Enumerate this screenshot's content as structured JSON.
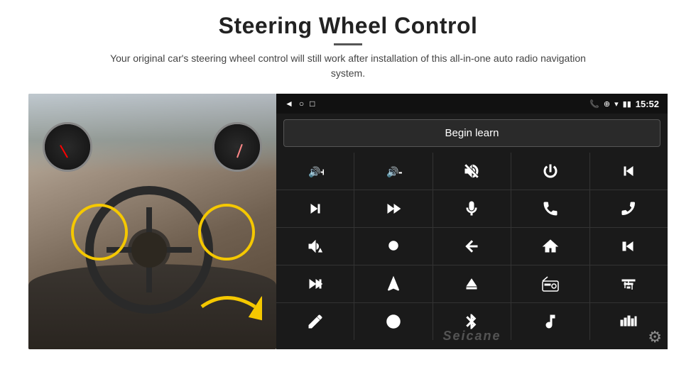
{
  "header": {
    "title": "Steering Wheel Control",
    "subtitle": "Your original car's steering wheel control will still work after installation of this all-in-one auto radio navigation system."
  },
  "statusbar": {
    "time": "15:52",
    "icons": [
      "◄",
      "○",
      "□",
      "📶",
      "📶"
    ]
  },
  "begin_learn": {
    "label": "Begin learn"
  },
  "controls": [
    {
      "icon": "vol_up",
      "symbol": "🔊+"
    },
    {
      "icon": "vol_down",
      "symbol": "🔊-"
    },
    {
      "icon": "mute",
      "symbol": "🔇"
    },
    {
      "icon": "power",
      "symbol": "⏻"
    },
    {
      "icon": "prev_track",
      "symbol": "⏮"
    },
    {
      "icon": "next_track",
      "symbol": "⏭"
    },
    {
      "icon": "ff_next",
      "symbol": "⏭⏭"
    },
    {
      "icon": "mic",
      "symbol": "🎤"
    },
    {
      "icon": "call",
      "symbol": "📞"
    },
    {
      "icon": "end_call",
      "symbol": "📵"
    },
    {
      "icon": "horn",
      "symbol": "📣"
    },
    {
      "icon": "settings_360",
      "symbol": "⚙360"
    },
    {
      "icon": "back",
      "symbol": "↩"
    },
    {
      "icon": "home",
      "symbol": "⌂"
    },
    {
      "icon": "rewind",
      "symbol": "⏮⏮"
    },
    {
      "icon": "ff",
      "symbol": "⏭"
    },
    {
      "icon": "navigation",
      "symbol": "▲"
    },
    {
      "icon": "eject",
      "symbol": "⏏"
    },
    {
      "icon": "radio",
      "symbol": "📻"
    },
    {
      "icon": "equalizer",
      "symbol": "🎚"
    },
    {
      "icon": "pen",
      "symbol": "✏"
    },
    {
      "icon": "steering2",
      "symbol": "🎯"
    },
    {
      "icon": "bluetooth",
      "symbol": "⚡"
    },
    {
      "icon": "music",
      "symbol": "🎵"
    },
    {
      "icon": "bars",
      "symbol": "|||"
    },
    {
      "icon": "gear",
      "symbol": "⚙"
    }
  ],
  "watermark": "Seicane",
  "colors": {
    "screen_bg": "#1a1a1a",
    "cell_bg": "#1a1a1a",
    "grid_gap": "#333",
    "statusbar_bg": "#111",
    "text_white": "#ffffff",
    "yellow_highlight": "#f5c800"
  }
}
